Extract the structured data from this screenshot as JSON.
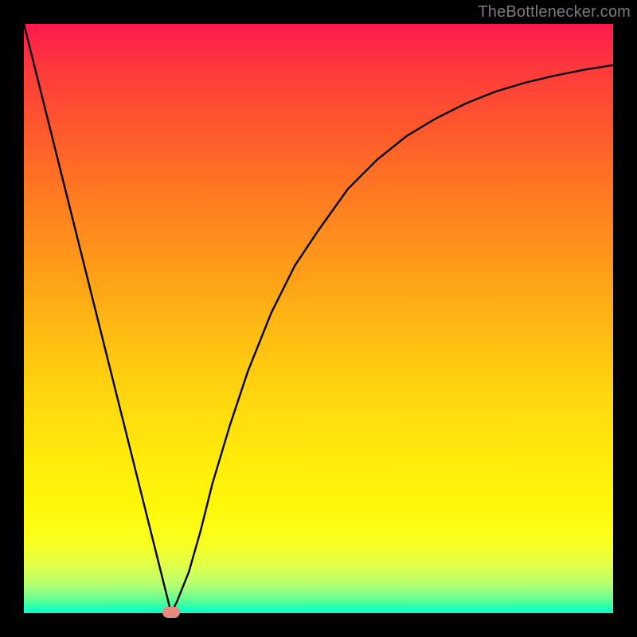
{
  "watermark": "TheBottlenecker.com",
  "chart_data": {
    "type": "line",
    "title": "",
    "xlabel": "",
    "ylabel": "",
    "xlim": [
      0,
      100
    ],
    "ylim": [
      0,
      100
    ],
    "grid": false,
    "legend": false,
    "series": [
      {
        "name": "bottleneck-curve",
        "x": [
          0,
          2,
          4,
          6,
          8,
          10,
          12,
          14,
          16,
          18,
          20,
          22,
          24,
          25,
          26,
          28,
          30,
          32,
          35,
          38,
          42,
          46,
          50,
          55,
          60,
          65,
          70,
          75,
          80,
          85,
          90,
          95,
          100
        ],
        "y": [
          100,
          92,
          84,
          76,
          68,
          60,
          52,
          44,
          36,
          28,
          20,
          12,
          4,
          0,
          2,
          7,
          14,
          22,
          32,
          41,
          51,
          59,
          65,
          72,
          77,
          81,
          84,
          86.5,
          88.5,
          90,
          91.2,
          92.2,
          93
        ]
      }
    ],
    "annotations": [
      {
        "name": "vertex-marker",
        "x": 25,
        "y": 0,
        "color": "#e88a80"
      }
    ],
    "colors": {
      "curve": "#000000",
      "gradient_top": "#ff1a4d",
      "gradient_bottom": "#00ffc8"
    }
  }
}
